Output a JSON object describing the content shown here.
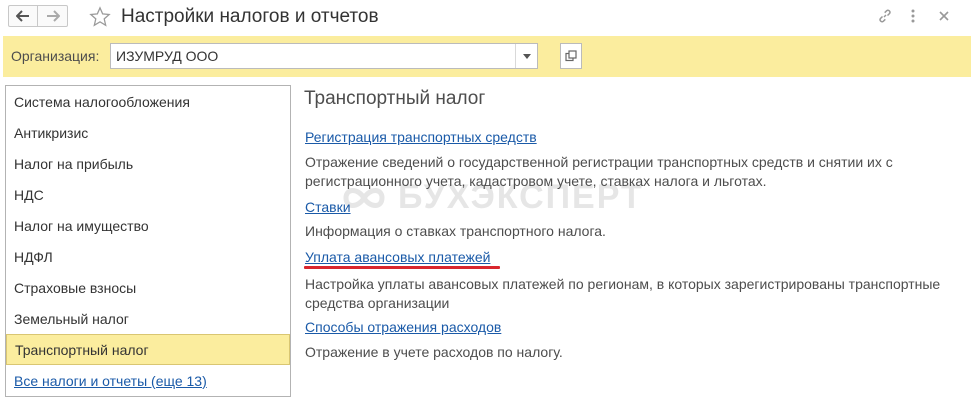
{
  "window": {
    "title": "Настройки налогов и отчетов"
  },
  "organization": {
    "label": "Организация:",
    "value": "ИЗУМРУД ООО"
  },
  "sidebar": {
    "items": [
      {
        "label": "Система налогообложения"
      },
      {
        "label": "Антикризис"
      },
      {
        "label": "Налог на прибыль"
      },
      {
        "label": "НДС"
      },
      {
        "label": "Налог на имущество"
      },
      {
        "label": "НДФЛ"
      },
      {
        "label": "Страховые взносы"
      },
      {
        "label": "Земельный налог"
      },
      {
        "label": "Транспортный налог",
        "selected": true
      }
    ],
    "all_link": "Все налоги и отчеты (еще 13)"
  },
  "content": {
    "heading": "Транспортный налог",
    "sections": [
      {
        "link": "Регистрация транспортных средств",
        "desc": "Отражение сведений о государственной регистрации транспортных средств и снятии их с регистрационного учета, кадастровом учете, ставках налога и льготах."
      },
      {
        "link": "Ставки",
        "desc": "Информация о ставках транспортного налога."
      },
      {
        "link": "Уплата авансовых платежей",
        "desc": "Настройка уплаты авансовых платежей по регионам, в которых зарегистрированы транспортные средства организации",
        "highlighted": true
      },
      {
        "link": "Способы отражения расходов",
        "desc": "Отражение в учете расходов по налогу."
      }
    ]
  },
  "watermark": {
    "text": "БУХЭКСПЕРТ"
  },
  "colors": {
    "accent_yellow": "#fbed9e",
    "link_blue": "#1a5aa8",
    "underline_red": "#d9262e"
  },
  "icons": {
    "back": "arrow-left-icon",
    "forward": "arrow-right-icon",
    "favorite": "star-outline-icon",
    "link": "link-icon",
    "more": "more-vertical-icon",
    "close": "close-icon",
    "dropdown": "chevron-down-icon",
    "open": "open-form-icon",
    "watermark_logo": "infinity-logo-icon"
  }
}
